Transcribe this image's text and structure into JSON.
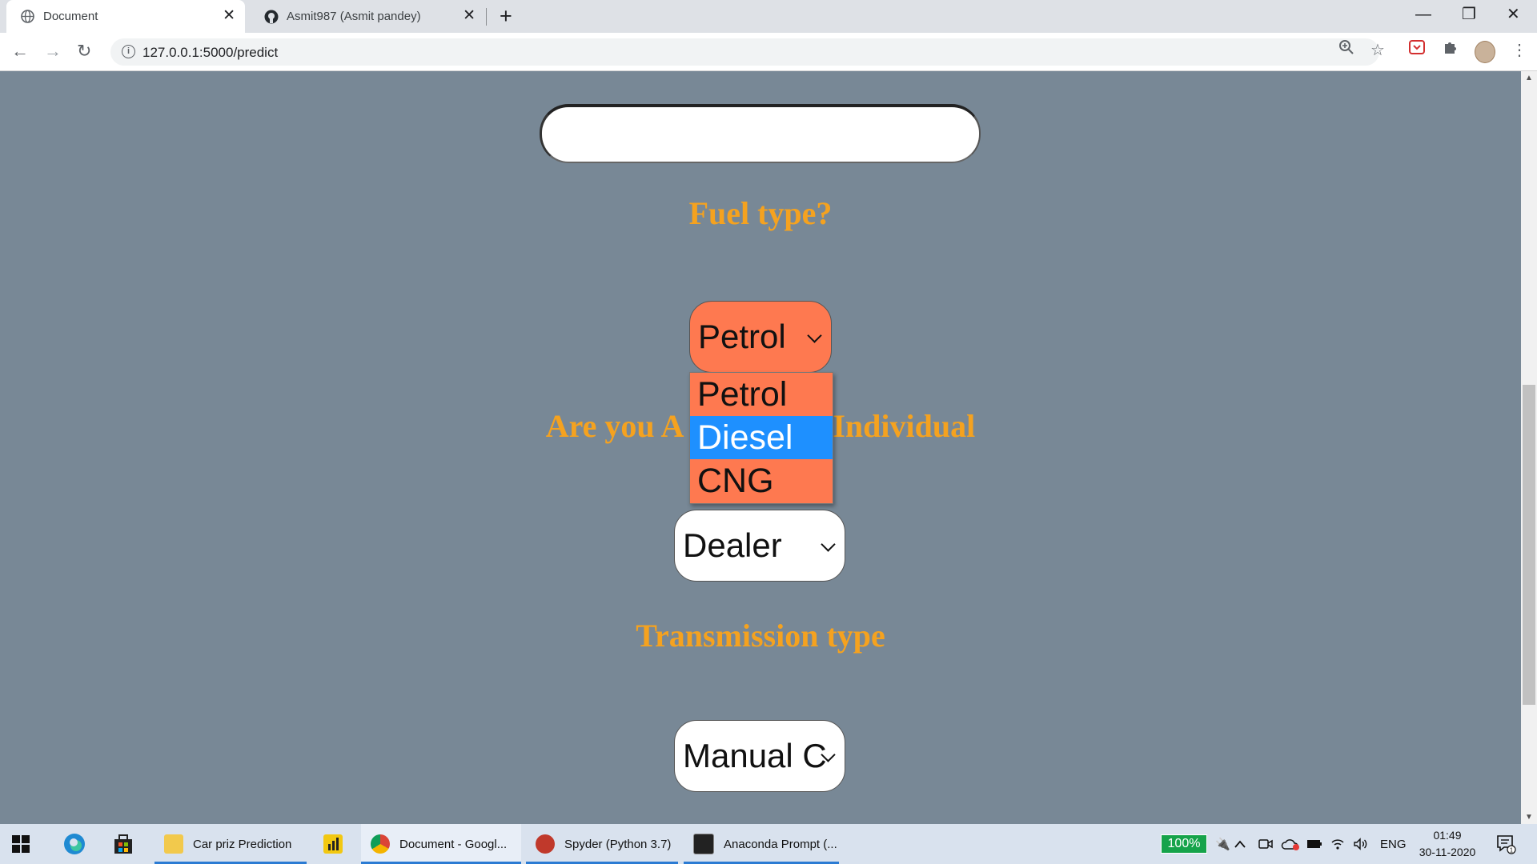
{
  "browser": {
    "tabs": [
      {
        "title": "Document",
        "active": true,
        "icon": "globe-icon"
      },
      {
        "title": "Asmit987 (Asmit pandey)",
        "active": false,
        "icon": "github-icon"
      }
    ],
    "url": "127.0.0.1:5000/predict"
  },
  "form": {
    "fuel_label": "Fuel type?",
    "fuel_selected": "Petrol",
    "fuel_options": [
      "Petrol",
      "Diesel",
      "CNG"
    ],
    "fuel_highlighted": "Diesel",
    "seller_label_left": "Are you A",
    "seller_label_right": "Individual",
    "seller_selected": "Dealer",
    "transmission_label": "Transmission type",
    "transmission_selected": "Manual C"
  },
  "taskbar": {
    "apps": [
      {
        "label": "Car priz Prediction",
        "icon": "folder-icon"
      },
      {
        "label": "Document - Googl...",
        "icon": "chrome-icon"
      },
      {
        "label": "Spyder (Python 3.7)",
        "icon": "spyder-icon"
      },
      {
        "label": "Anaconda Prompt (...",
        "icon": "terminal-icon"
      }
    ],
    "battery": "100%",
    "language": "ENG",
    "time": "01:49",
    "date": "30-11-2020",
    "notifications": "1"
  },
  "colors": {
    "page_bg": "#788896",
    "label_color": "#f5a21f",
    "fuel_select_bg": "#fe7950",
    "highlight": "#1e90ff"
  }
}
